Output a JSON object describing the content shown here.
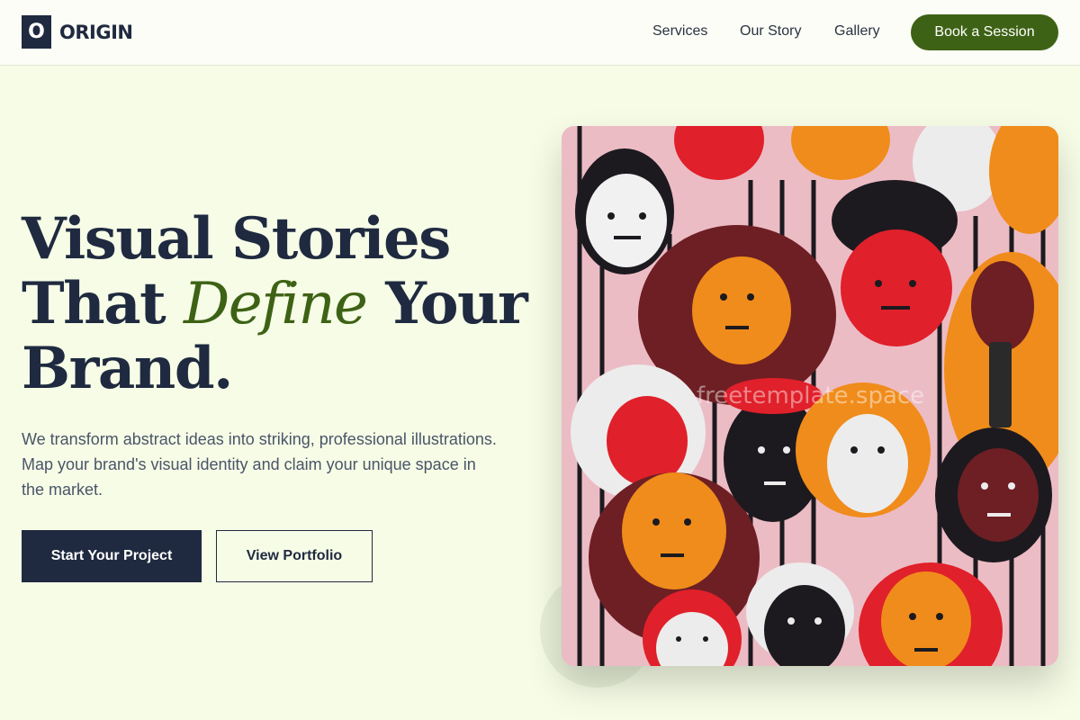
{
  "brand": {
    "mark": "O",
    "name": "ORIGIN"
  },
  "nav": {
    "items": [
      "Services",
      "Our Story",
      "Gallery"
    ],
    "cta": "Book a Session"
  },
  "hero": {
    "headline_line1": "Visual Stories",
    "headline_line2_start": "That",
    "headline_line2_accent": "Define",
    "headline_line2_end": "Your",
    "headline_line3": "Brand.",
    "subtext": "We transform abstract ideas into striking, professional illustrations. Map your brand's visual identity and claim your unique space in the market.",
    "primary_button": "Start Your Project",
    "secondary_button": "View Portfolio"
  },
  "image": {
    "watermark": "freetemplate.space"
  },
  "colors": {
    "accent": "#3e6215",
    "navy": "#1f2a40",
    "background": "#f6fce6"
  }
}
